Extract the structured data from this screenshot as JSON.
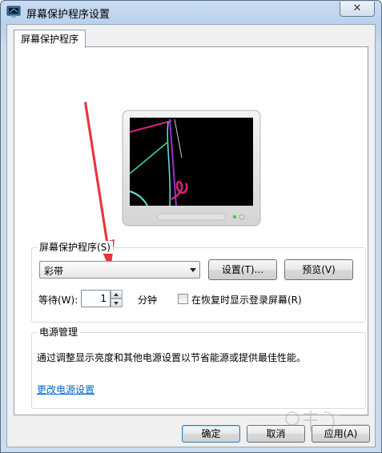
{
  "window": {
    "title": "屏幕保护程序设置",
    "close_label": "✕"
  },
  "tab": {
    "label": "屏幕保护程序"
  },
  "screensaver": {
    "group_label": "屏幕保护程序(S)",
    "selected": "彩带",
    "settings_button": "设置(T)...",
    "preview_button": "预览(V)",
    "wait_label": "等待(W):",
    "wait_value": "1",
    "minutes_label": "分钟",
    "resume_checkbox_label": "在恢复时显示登录屏幕(R)",
    "resume_checked": false
  },
  "power": {
    "group_label": "电源管理",
    "description": "通过调整显示亮度和其他电源设置以节省能源或提供最佳性能。",
    "link": "更改电源设置"
  },
  "footer": {
    "ok": "确定",
    "cancel": "取消",
    "apply": "应用(A)"
  },
  "colors": {
    "accent_arrow": "#e8343a",
    "link": "#0066cc",
    "title_bar": "#c9dcf2"
  }
}
